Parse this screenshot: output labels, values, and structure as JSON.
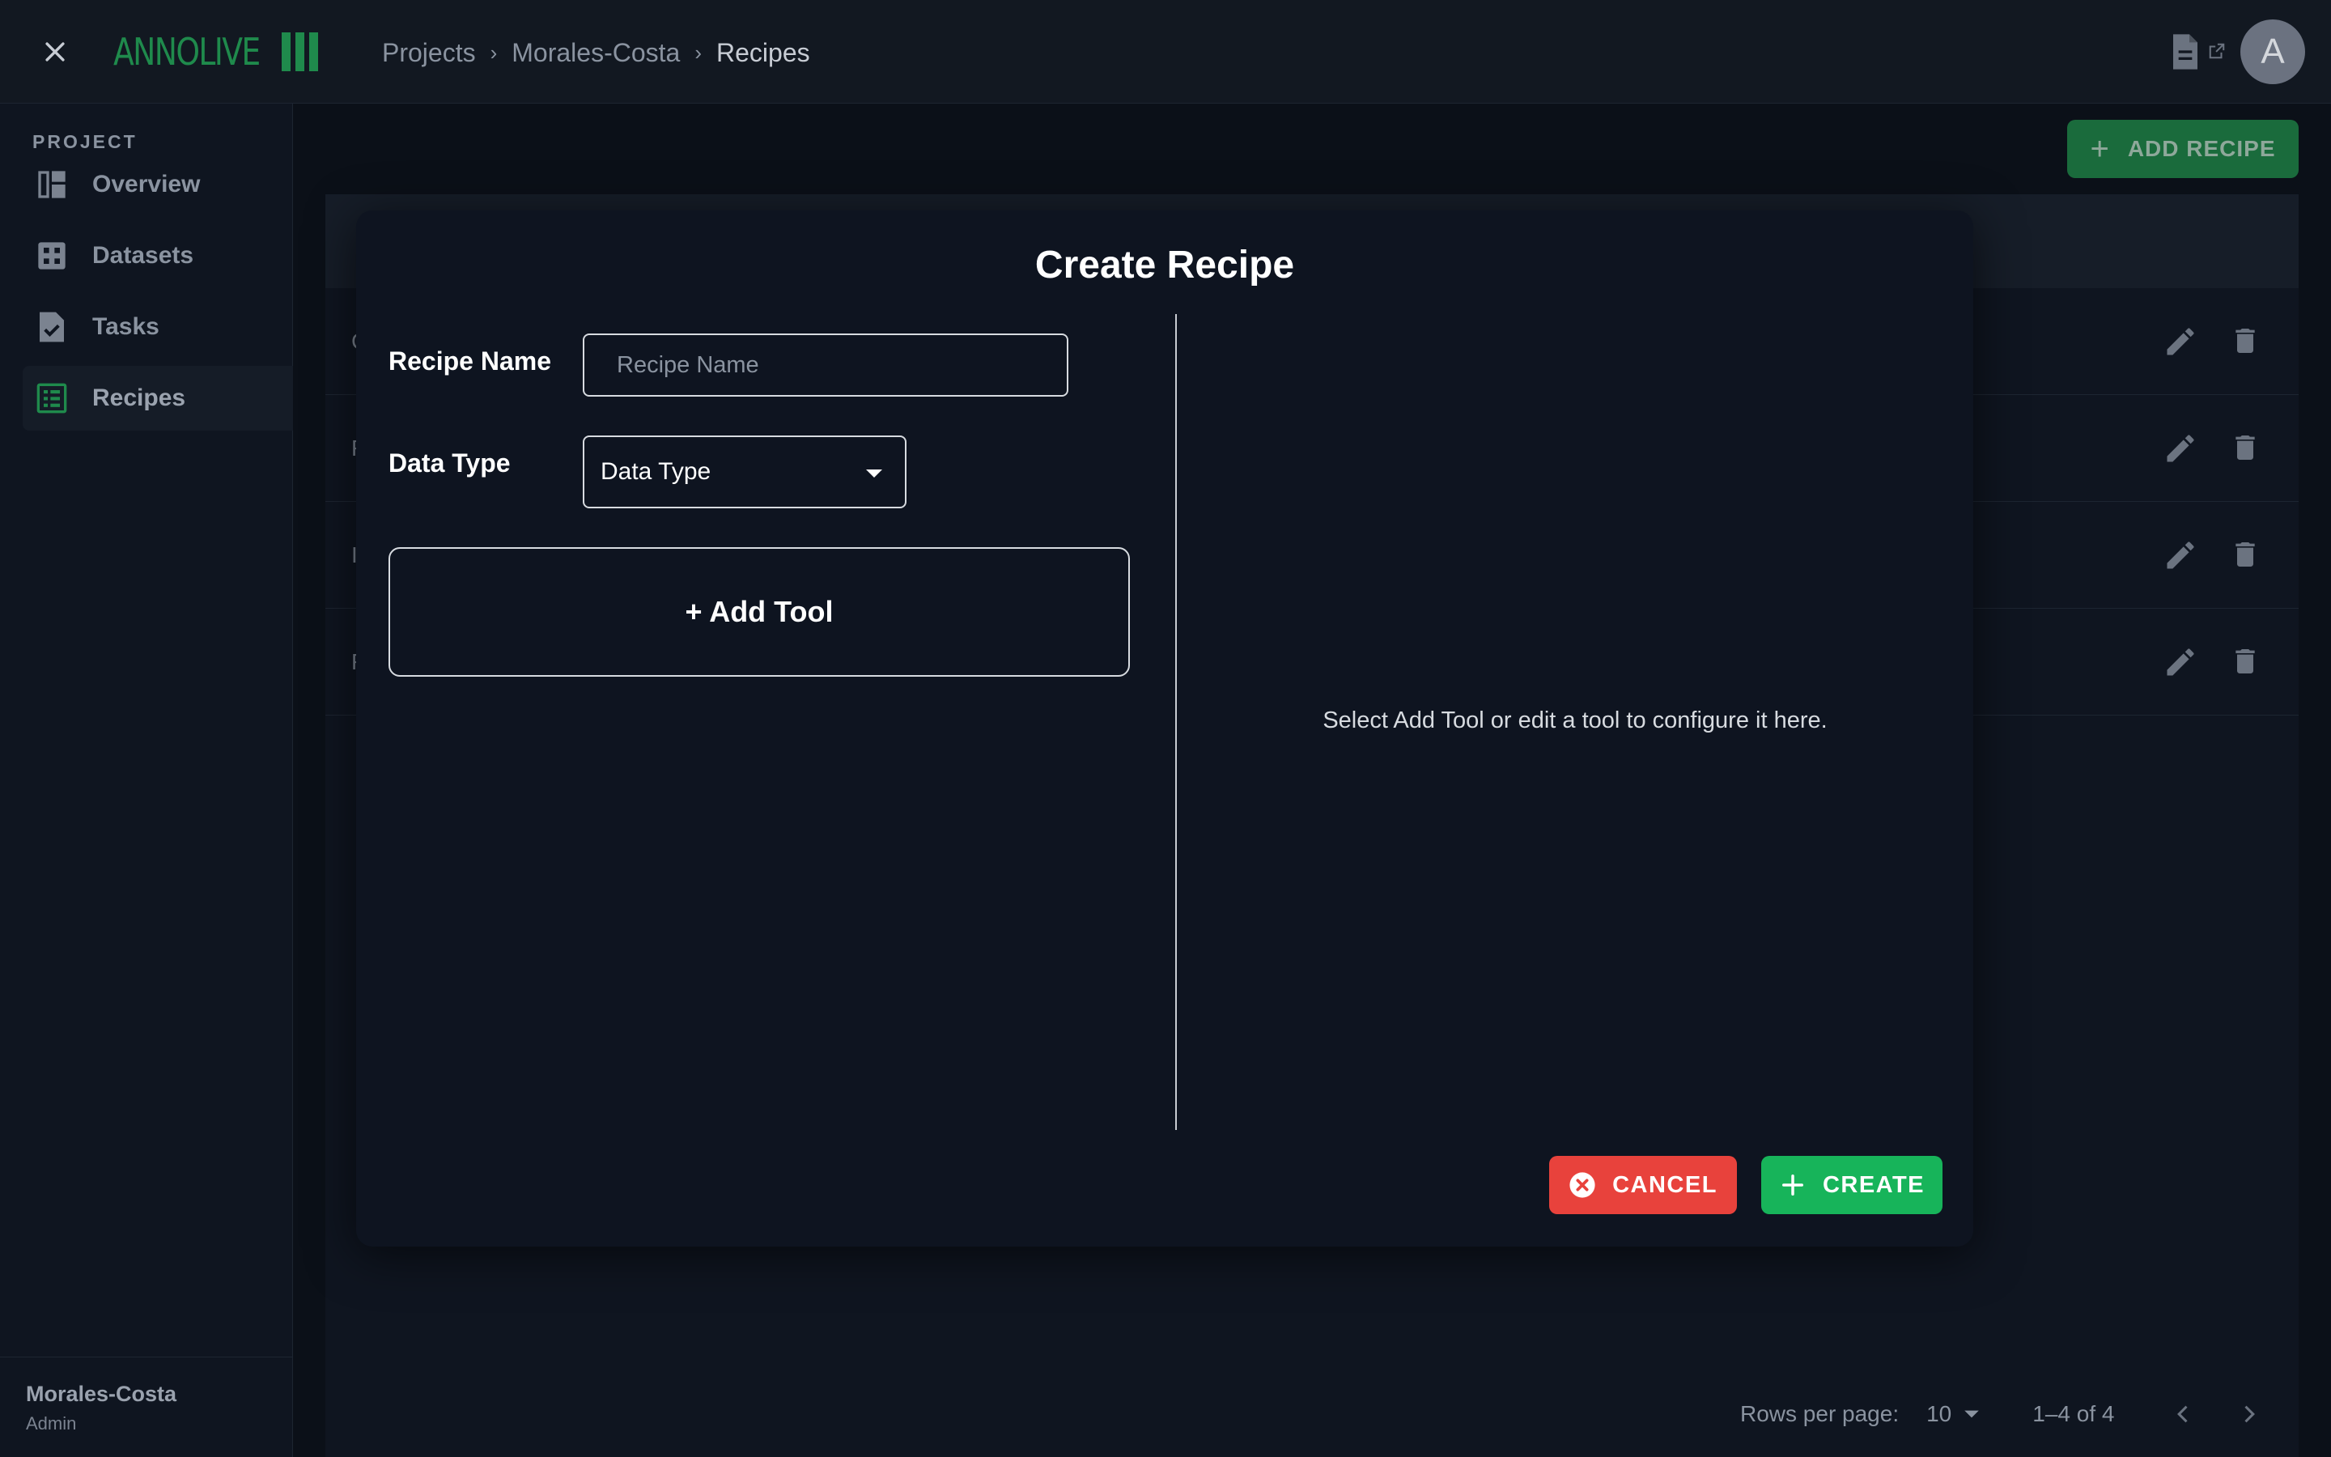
{
  "app": {
    "logo_text": "ANNOLIVE",
    "accent": "#1f8a4c"
  },
  "breadcrumb": {
    "items": [
      "Projects",
      "Morales-Costa",
      "Recipes"
    ]
  },
  "user": {
    "avatar_letter": "A"
  },
  "sidebar": {
    "heading": "PROJECT",
    "items": [
      {
        "label": "Overview",
        "icon": "dashboard-icon"
      },
      {
        "label": "Datasets",
        "icon": "grid-icon"
      },
      {
        "label": "Tasks",
        "icon": "task-doc-icon"
      },
      {
        "label": "Recipes",
        "icon": "list-icon",
        "active": true
      }
    ],
    "footer": {
      "project": "Morales-Costa",
      "role": "Admin"
    }
  },
  "page": {
    "add_recipe_label": "ADD RECIPE",
    "rows": [
      {
        "fragment": "C"
      },
      {
        "fragment": "F"
      },
      {
        "fragment": "I"
      },
      {
        "fragment": "F"
      }
    ],
    "pagination": {
      "rows_per_page_label": "Rows per page:",
      "rows_per_page": "10",
      "range": "1–4 of 4"
    }
  },
  "dialog": {
    "title": "Create Recipe",
    "recipe_name_label": "Recipe Name",
    "recipe_name_value": "",
    "recipe_name_placeholder": "Recipe Name",
    "data_type_label": "Data Type",
    "data_type_value": "Data Type",
    "add_tool_label": "+ Add Tool",
    "hint": "Select Add Tool or edit a tool to configure it here.",
    "cancel_label": "CANCEL",
    "create_label": "CREATE",
    "colors": {
      "cancel": "#e8423c",
      "create": "#17b45a"
    }
  }
}
